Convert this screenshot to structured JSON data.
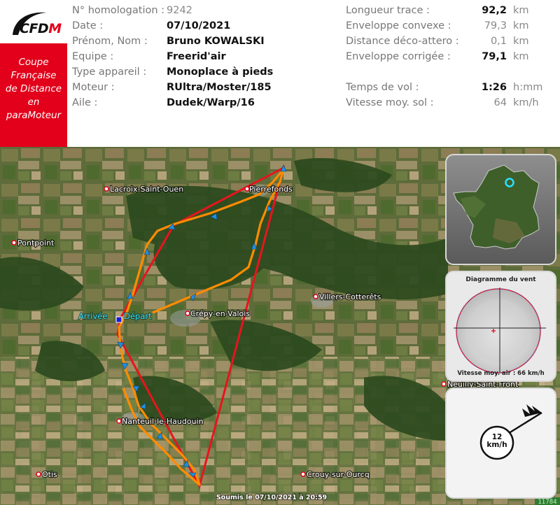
{
  "logo": {
    "brand": "CFDM",
    "tagline_lines": [
      "Coupe",
      "Française",
      "de Distance",
      "en",
      "paraMoteur"
    ]
  },
  "info": {
    "homologation": {
      "label": "N° homologation :",
      "value": "9242"
    },
    "date": {
      "label": "Date :",
      "value": "07/10/2021"
    },
    "pilot": {
      "label": "Prénom, Nom :",
      "value": "Bruno KOWALSKI"
    },
    "team": {
      "label": "Equipe :",
      "value": "Freerid'air"
    },
    "aircraft_type": {
      "label": "Type appareil :",
      "value": "Monoplace à pieds"
    },
    "engine": {
      "label": "Moteur :",
      "value": "RUltra/Moster/185"
    },
    "wing": {
      "label": "Aile :",
      "value": "Dudek/Warp/16"
    }
  },
  "stats": {
    "track_length": {
      "label": "Longueur trace :",
      "value": "92,2",
      "unit": "km"
    },
    "convex_hull": {
      "label": "Enveloppe convexe :",
      "value": "79,3",
      "unit": "km"
    },
    "takeoff_landing": {
      "label": "Distance déco-attero :",
      "value": "0,1",
      "unit": "km"
    },
    "corrected_hull": {
      "label": "Enveloppe corrigée :",
      "value": "79,1",
      "unit": "km"
    },
    "flight_time": {
      "label": "Temps de vol :",
      "value": "1:26",
      "unit": "h:mm"
    },
    "ground_speed": {
      "label": "Vitesse moy. sol :",
      "value": "64",
      "unit": "km/h"
    }
  },
  "map": {
    "places": [
      "Lacroix-Saint-Ouen",
      "Pierrefonds",
      "Pontpoint",
      "Villers-Cotterêts",
      "Crépy-en-Valois",
      "Neuilly-Saint-Front",
      "Nanteuil-le-Haudouin",
      "Otis",
      "Crouy-sur-Ourcq"
    ],
    "arrival_label": "Arrivée",
    "departure_label": "Départ",
    "submitted": "Soumis le 07/10/2021 à 20:59",
    "id_badge": "11784"
  },
  "wind_diagram": {
    "title": "Diagramme du vent",
    "air_speed": "Vitesse moy. air : 66 km/h"
  },
  "wind_gauge": {
    "speed": "12",
    "unit": "km/h"
  },
  "colors": {
    "accent": "#e2001a",
    "track": "#ff8c00",
    "hull": "#e8141e",
    "labels": "#38d9ef"
  }
}
